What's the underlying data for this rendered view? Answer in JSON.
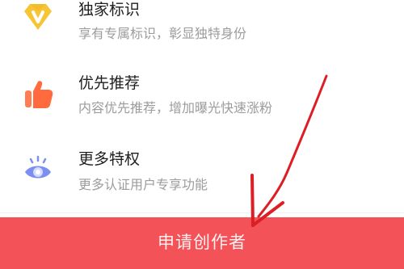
{
  "benefits": [
    {
      "icon": "diamond-v-icon",
      "title": "独家标识",
      "subtitle": "享有专属标识，彰显独特身份"
    },
    {
      "icon": "thumbs-up-icon",
      "title": "优先推荐",
      "subtitle": "内容优先推荐，增加曝光快速涨粉"
    },
    {
      "icon": "eye-icon",
      "title": "更多特权",
      "subtitle": "更多认证用户专享功能"
    }
  ],
  "footer": {
    "apply_label": "申请创作者"
  },
  "colors": {
    "button": "#f25258",
    "annotation_arrow": "#dc1f24",
    "diamond": "#f7c534",
    "thumbs_up": "#ff6b45",
    "eye": "#7c8ff0"
  },
  "annotation": {
    "type": "arrow",
    "target": "apply-button"
  }
}
